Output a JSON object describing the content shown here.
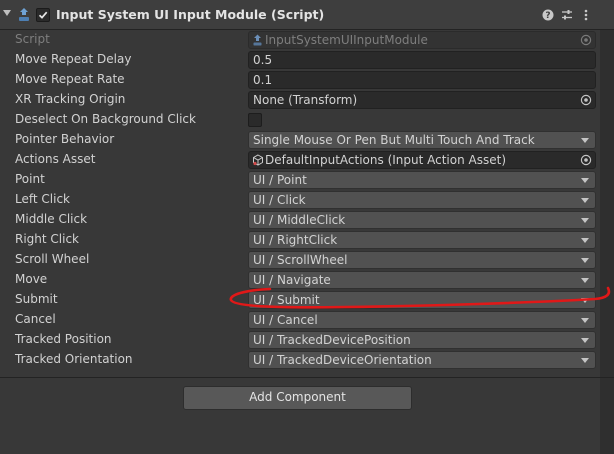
{
  "component": {
    "title": "Input System UI Input Module (Script)",
    "enabled": true
  },
  "fields": {
    "script": {
      "label": "Script",
      "value": "InputSystemUIInputModule"
    },
    "move_repeat_delay": {
      "label": "Move Repeat Delay",
      "value": "0.5"
    },
    "move_repeat_rate": {
      "label": "Move Repeat Rate",
      "value": "0.1"
    },
    "xr_tracking_origin": {
      "label": "XR Tracking Origin",
      "value": "None (Transform)"
    },
    "deselect_on_background_click": {
      "label": "Deselect On Background Click",
      "checked": false
    },
    "pointer_behavior": {
      "label": "Pointer Behavior",
      "value": "Single Mouse Or Pen But Multi Touch And Track"
    },
    "actions_asset": {
      "label": "Actions Asset",
      "value": "DefaultInputActions (Input Action Asset)"
    },
    "point": {
      "label": "Point",
      "value": "UI / Point"
    },
    "left_click": {
      "label": "Left Click",
      "value": "UI / Click"
    },
    "middle_click": {
      "label": "Middle Click",
      "value": "UI / MiddleClick"
    },
    "right_click": {
      "label": "Right Click",
      "value": "UI / RightClick"
    },
    "scroll_wheel": {
      "label": "Scroll Wheel",
      "value": "UI / ScrollWheel"
    },
    "move": {
      "label": "Move",
      "value": "UI / Navigate"
    },
    "submit": {
      "label": "Submit",
      "value": "UI / Submit"
    },
    "cancel": {
      "label": "Cancel",
      "value": "UI / Cancel"
    },
    "tracked_position": {
      "label": "Tracked Position",
      "value": "UI / TrackedDevicePosition"
    },
    "tracked_orientation": {
      "label": "Tracked Orientation",
      "value": "UI / TrackedDeviceOrientation"
    }
  },
  "add_component_label": "Add Component",
  "colors": {
    "annotation_stroke": "#e01818",
    "panel_bg": "#383838",
    "field_bg": "#2a2a2a",
    "popup_bg": "#515151"
  }
}
